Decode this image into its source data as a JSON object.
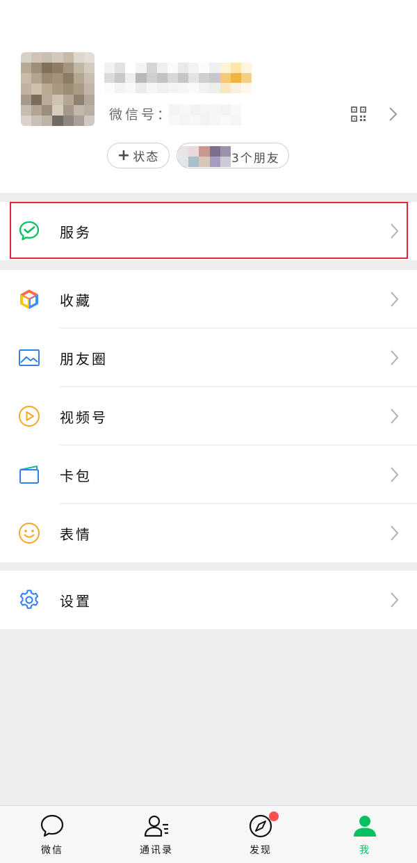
{
  "profile": {
    "wechat_id_label": "微信号：",
    "status_button": "状态",
    "friends_text": "3个朋友"
  },
  "menu_groups": [
    [
      {
        "label": "服务",
        "icon": "wechat-pay-icon"
      }
    ],
    [
      {
        "label": "收藏",
        "icon": "favorites-cube-icon"
      },
      {
        "label": "朋友圈",
        "icon": "moments-picture-icon"
      },
      {
        "label": "视频号",
        "icon": "channels-play-icon"
      },
      {
        "label": "卡包",
        "icon": "card-wallet-icon"
      },
      {
        "label": "表情",
        "icon": "sticker-smiley-icon"
      }
    ],
    [
      {
        "label": "设置",
        "icon": "settings-gear-icon"
      }
    ]
  ],
  "tabs": [
    {
      "label": "微信",
      "icon": "chat-bubble-icon",
      "active": false
    },
    {
      "label": "通讯录",
      "icon": "contacts-icon",
      "active": false
    },
    {
      "label": "发现",
      "icon": "discover-compass-icon",
      "active": false,
      "badge": true
    },
    {
      "label": "我",
      "icon": "me-person-icon",
      "active": true
    }
  ],
  "colors": {
    "accent": "#07c160",
    "highlight_border": "#e0272b",
    "badge": "#fa5151"
  }
}
